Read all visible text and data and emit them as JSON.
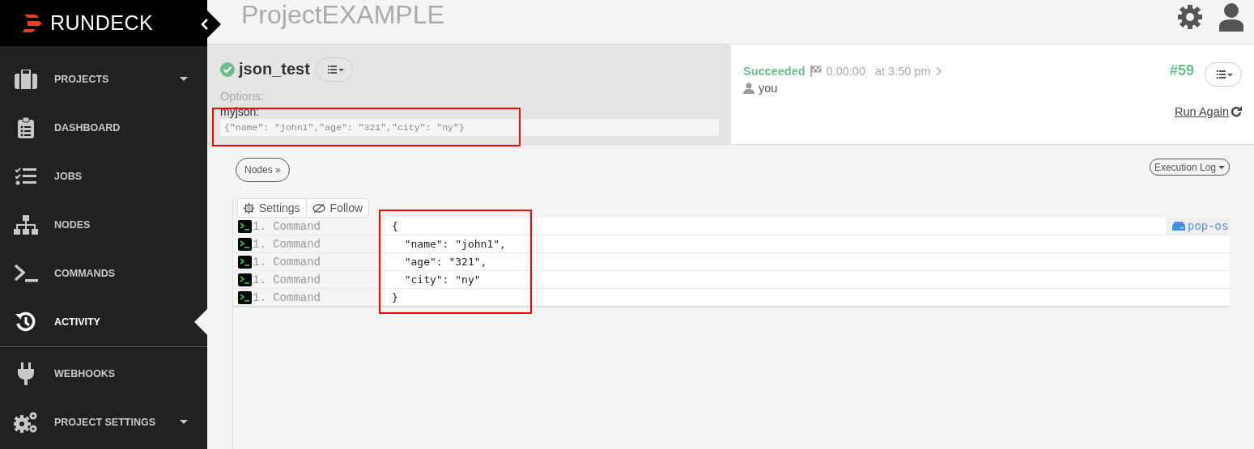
{
  "sidebar": {
    "brand": "RUNDECK",
    "sections": [
      {
        "items": [
          {
            "label": "PROJECTS",
            "caret": true,
            "selected": false
          },
          {
            "label": "DASHBOARD",
            "caret": false,
            "selected": false
          },
          {
            "label": "JOBS",
            "caret": false,
            "selected": false
          },
          {
            "label": "NODES",
            "caret": false,
            "selected": false
          },
          {
            "label": "COMMANDS",
            "caret": false,
            "selected": false
          },
          {
            "label": "ACTIVITY",
            "caret": false,
            "selected": true
          }
        ]
      },
      {
        "items": [
          {
            "label": "WEBHOOKS",
            "caret": false,
            "selected": false
          },
          {
            "label": "PROJECT SETTINGS",
            "caret": true,
            "selected": false
          }
        ]
      }
    ]
  },
  "header": {
    "project": "ProjectEXAMPLE"
  },
  "execution": {
    "job": "json_test",
    "options_label": "Options:",
    "options": [
      {
        "name": "myjson:",
        "value": "{\"name\": \"john1\",\"age\": \"321\",\"city\": \"ny\"}"
      }
    ],
    "status": "Succeeded",
    "duration": "0.00:00",
    "time": "at 3:50 pm",
    "user": "you",
    "number": "#59",
    "run_again": "Run Again"
  },
  "log": {
    "nodes_button": "Nodes »",
    "view_button": "Execution Log",
    "settings": "Settings",
    "follow": "Follow",
    "rows": [
      {
        "step": "1. Command",
        "output": "{",
        "node": "pop-os"
      },
      {
        "step": "1. Command",
        "output": "  \"name\": \"john1\","
      },
      {
        "step": "1. Command",
        "output": "  \"age\": \"321\","
      },
      {
        "step": "1. Command",
        "output": "  \"city\": \"ny\""
      },
      {
        "step": "1. Command",
        "output": "}"
      }
    ]
  },
  "annotations": [
    {
      "kind": "highlight"
    },
    {
      "kind": "highlight"
    }
  ]
}
